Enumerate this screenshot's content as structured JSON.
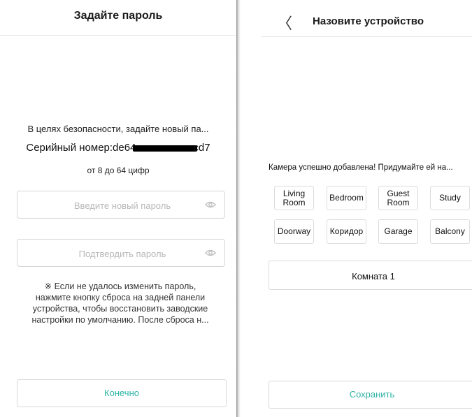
{
  "left": {
    "title": "Задайте пароль",
    "info": "В целях безопасности, задайте новый па...",
    "serial_prefix": "Серийный номер:de64",
    "serial_suffix": "cd7",
    "range": "от 8 до 64 цифр",
    "new_password_placeholder": "Введите новый пароль",
    "confirm_password_placeholder": "Подтвердить пароль",
    "note_lines": [
      "※ Если не удалось изменить пароль,",
      "нажмите кнопку сброса на задней панели",
      "устройства, чтобы восстановить заводские",
      "настройки по умолчанию. После сброса н..."
    ],
    "ok_label": "Конечно"
  },
  "right": {
    "title": "Назовите устройство",
    "back_glyph": "〈",
    "added_text": "Камера успешно добавлена! Придумайте ей на...",
    "tags": [
      "Living Room",
      "Bedroom",
      "Guest Room",
      "Study",
      "Doorway",
      "Коридор",
      "Garage",
      "Balcony"
    ],
    "name_value": "Комната 1",
    "save_label": "Сохранить"
  },
  "colors": {
    "accent": "#2fb3a6",
    "border": "#d9d9d9",
    "placeholder": "#b8b8b8"
  },
  "icons": {
    "password_toggle": "eye-icon",
    "back": "chevron-left-icon"
  }
}
